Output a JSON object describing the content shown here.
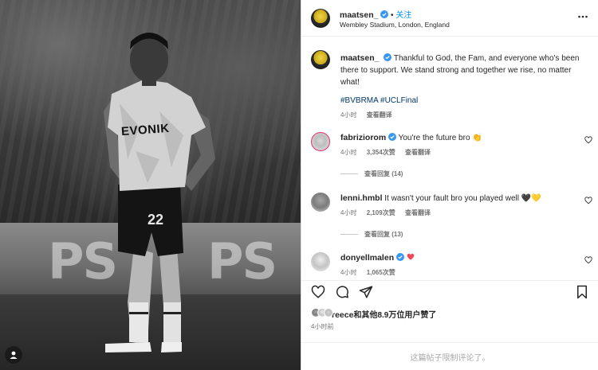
{
  "post": {
    "author": "maatsen_",
    "follow_label": "关注",
    "location": "Wembley Stadium, London, England",
    "caption": "Thankful to God, the Fam, and everyone who's been there to support. We stand strong and together we rise, no matter what!",
    "hashtags": "#BVBRMA #UCLFinal",
    "caption_time": "4小时",
    "see_translation": "查看翻译",
    "liked_by_user": "reece",
    "liked_by_rest": "和其他8.9万位用户赞了",
    "post_time": "4小时前",
    "comments_limited": "这篇帖子限制评论了。"
  },
  "photo": {
    "jersey_sponsor": "EVONIK",
    "jersey_number": "22",
    "board_text": "PS"
  },
  "comments": [
    {
      "user": "fabriziorom",
      "verified": true,
      "text": "You're the future bro 👏",
      "time": "4小时",
      "likes": "3,354次赞",
      "translate": "查看翻译",
      "replies": "查看回复 (14)"
    },
    {
      "user": "lenni.hmbl",
      "verified": false,
      "text": "It wasn't your fault bro you played well 🖤💛",
      "time": "4小时",
      "likes": "2,109次赞",
      "translate": "查看翻译",
      "replies": "查看回复 (13)"
    },
    {
      "user": "donyellmalen",
      "verified": true,
      "text": "",
      "time": "4小时",
      "likes": "1,065次赞"
    }
  ],
  "icons": {
    "like": "heart-icon",
    "comment": "comment-icon",
    "share": "paper-plane-icon",
    "save": "bookmark-icon",
    "more": "more-horizontal-icon",
    "verified": "verified-badge-icon"
  },
  "colors": {
    "link_blue": "#0095f6",
    "hashtag": "#00376b",
    "verified": "#3897f0",
    "muted": "#737373",
    "heart": "#ed4956"
  }
}
